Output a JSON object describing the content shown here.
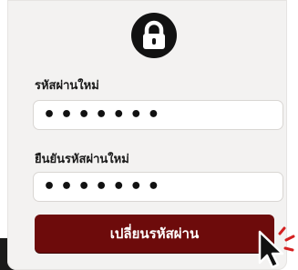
{
  "form": {
    "new_password_label": "รหัสผ่านใหม่",
    "new_password_value": "•••••••",
    "confirm_password_label": "ยืนยันรหัสผ่านใหม่",
    "confirm_password_value": "•••••••",
    "submit_label": "เปลี่ยนรหัสผ่าน"
  },
  "icons": {
    "lock": "lock-icon",
    "cursor": "mouse-pointer-icon"
  },
  "colors": {
    "button": "#6d0b0b",
    "card_background": "#f3f2f1",
    "lock_circle": "#121212",
    "click_marks": "#d42020"
  }
}
